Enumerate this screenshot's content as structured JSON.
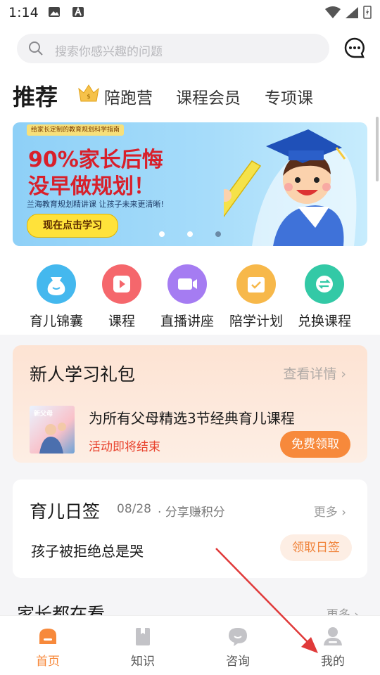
{
  "status_bar": {
    "time": "1:14"
  },
  "search": {
    "placeholder": "搜索你感兴趣的问题"
  },
  "tabs": {
    "active": "推荐",
    "items": [
      "陪跑营",
      "课程会员",
      "专项课"
    ]
  },
  "banner": {
    "tag": "给家长定制的教育规划科学指南",
    "headline_1": "90%家长后悔",
    "headline_2": "没早做规划！",
    "subtitle": "兰海教育规划精讲课 让孩子未来更清晰!",
    "button": "现在点击学习"
  },
  "quick_icons": [
    {
      "label": "育儿锦囊",
      "color": "#44b8ee"
    },
    {
      "label": "课程",
      "color": "#f5676c"
    },
    {
      "label": "直播讲座",
      "color": "#a57cf2"
    },
    {
      "label": "陪学计划",
      "color": "#f7b84a"
    },
    {
      "label": "兑换课程",
      "color": "#33c9a6"
    }
  ],
  "gift_card": {
    "title": "新人学习礼包",
    "detail_link": "查看详情",
    "book_label": "新父母",
    "description": "为所有父母精选3节经典育儿课程",
    "ending": "活动即将结束",
    "claim_button": "免费领取"
  },
  "daily_card": {
    "title": "育儿日签",
    "date": "08/28",
    "share": "· 分享赚积分",
    "more": "更多",
    "question": "孩子被拒绝总是哭",
    "sign_button": "领取日签"
  },
  "section": {
    "title": "家长都在看",
    "more": "更多"
  },
  "tab_bar": [
    {
      "label": "首页",
      "active": true
    },
    {
      "label": "知识",
      "active": false
    },
    {
      "label": "咨询",
      "active": false
    },
    {
      "label": "我的",
      "active": false
    }
  ],
  "colors": {
    "accent": "#f7893b",
    "annotation": "#e03a3a"
  }
}
